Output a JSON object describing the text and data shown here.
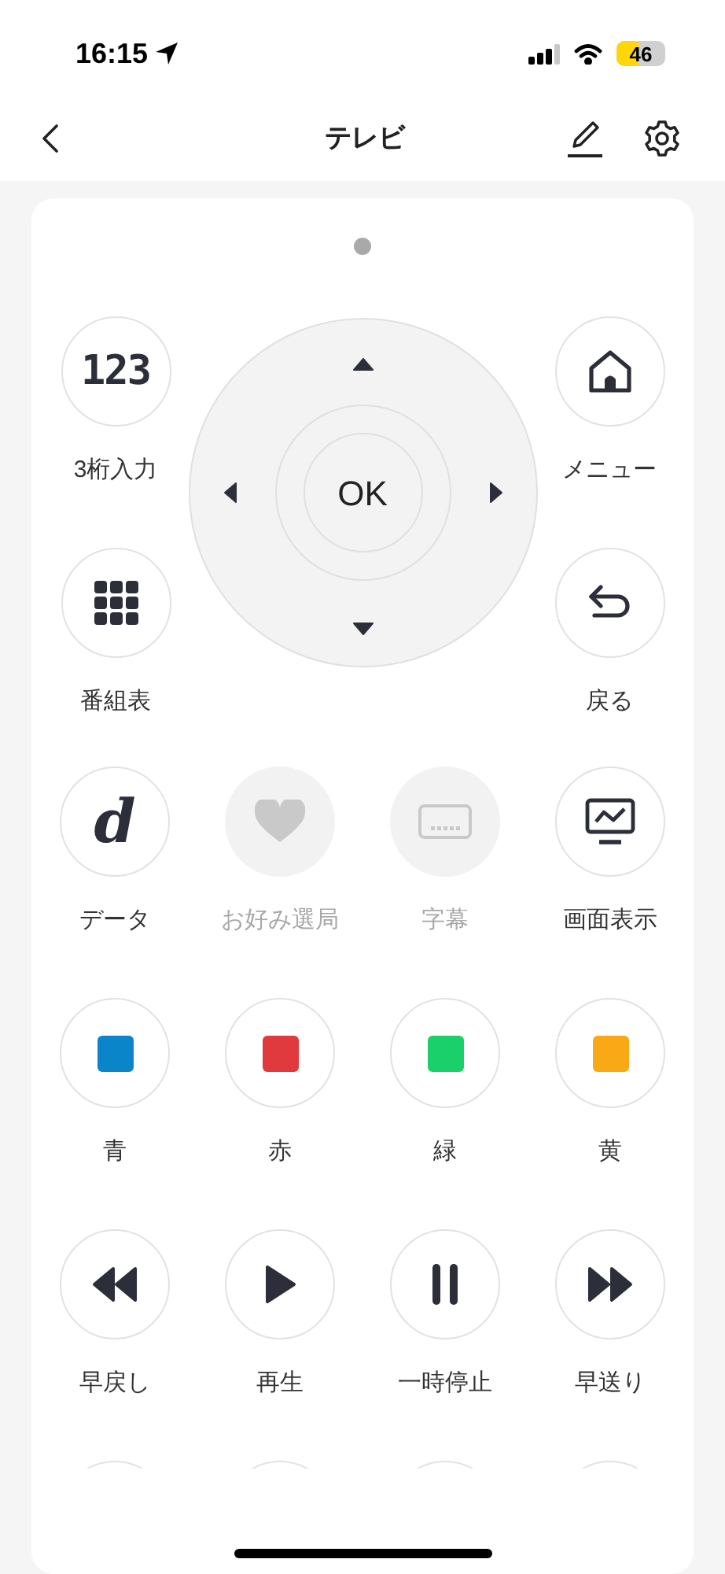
{
  "status_bar": {
    "time": "16:15",
    "battery": "46"
  },
  "nav": {
    "title": "テレビ"
  },
  "top_keys": {
    "left": [
      {
        "kind": "digits",
        "glyph": "123",
        "label": "3桁入力"
      },
      {
        "kind": "grid",
        "label": "番組表"
      }
    ],
    "right": [
      {
        "kind": "home",
        "label": "メニュー"
      },
      {
        "kind": "return",
        "label": "戻る"
      }
    ]
  },
  "dpad": {
    "ok": "OK"
  },
  "rows": [
    [
      {
        "kind": "d",
        "glyph": "d",
        "label": "データ",
        "disabled": false
      },
      {
        "kind": "heart",
        "label": "お好み選局",
        "disabled": true
      },
      {
        "kind": "caption",
        "label": "字幕",
        "disabled": true
      },
      {
        "kind": "monitor",
        "label": "画面表示",
        "disabled": false
      }
    ],
    [
      {
        "kind": "color",
        "color": "#0a85c9",
        "label": "青",
        "disabled": false
      },
      {
        "kind": "color",
        "color": "#e0393e",
        "label": "赤",
        "disabled": false
      },
      {
        "kind": "color",
        "color": "#19d06b",
        "label": "緑",
        "disabled": false
      },
      {
        "kind": "color",
        "color": "#f9a915",
        "label": "黄",
        "disabled": false
      }
    ],
    [
      {
        "kind": "rewind",
        "label": "早戻し",
        "disabled": false
      },
      {
        "kind": "play",
        "label": "再生",
        "disabled": false
      },
      {
        "kind": "pause",
        "label": "一時停止",
        "disabled": false
      },
      {
        "kind": "forward",
        "label": "早送り",
        "disabled": false
      }
    ],
    [
      {
        "kind": "partial"
      },
      {
        "kind": "partial"
      },
      {
        "kind": "partial"
      },
      {
        "kind": "partial"
      }
    ]
  ]
}
